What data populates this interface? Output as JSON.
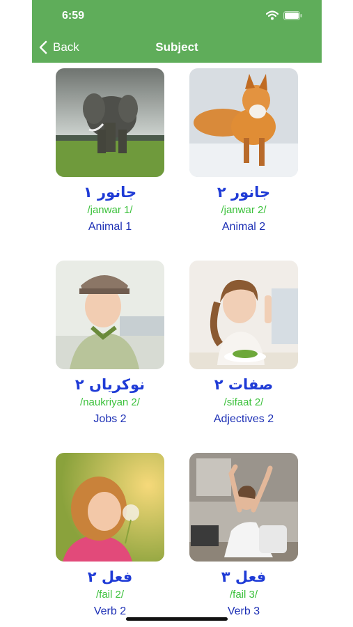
{
  "status_bar": {
    "time": "6:59"
  },
  "nav": {
    "back_label": "Back",
    "title": "Subject"
  },
  "items": [
    {
      "urdu": "جانور ۱",
      "translit": "/janwar 1/",
      "english": "Animal 1",
      "image": "elephant"
    },
    {
      "urdu": "جانور ۲",
      "translit": "/janwar 2/",
      "english": "Animal 2",
      "image": "fox"
    },
    {
      "urdu": "نوکریاں ۲",
      "translit": "/naukriyan 2/",
      "english": "Jobs 2",
      "image": "flight-attendant"
    },
    {
      "urdu": "صفات ۲",
      "translit": "/sifaat 2/",
      "english": "Adjectives 2",
      "image": "girl-thumbs-up"
    },
    {
      "urdu": "فعل ۲",
      "translit": "/fail 2/",
      "english": "Verb 2",
      "image": "girl-dandelion"
    },
    {
      "urdu": "فعل ۳",
      "translit": "/fail 3/",
      "english": "Verb 3",
      "image": "woman-stretching"
    }
  ],
  "colors": {
    "header": "#5fad5a",
    "urdu": "#1f3bd6",
    "translit": "#3cc13c",
    "english": "#1c2fb5"
  }
}
